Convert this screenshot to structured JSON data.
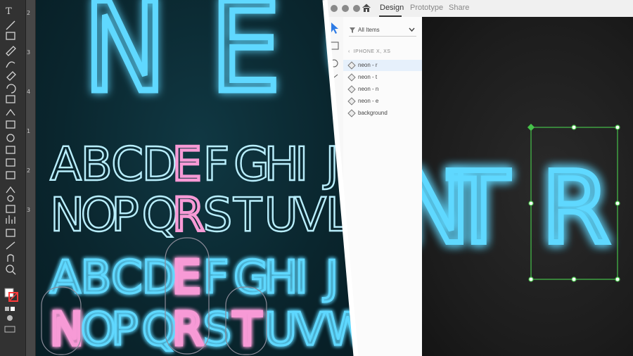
{
  "illustrator": {
    "ruler_marks": [
      "2",
      "3",
      "4",
      "1",
      "2",
      "3"
    ],
    "headline": "NEO",
    "alphabet_row1": [
      "A",
      "B",
      "C",
      "D",
      "E",
      "F",
      "G",
      "H",
      "I",
      "J"
    ],
    "alphabet_row2": [
      "N",
      "O",
      "P",
      "Q",
      "R",
      "S",
      "T",
      "U",
      "V",
      "L"
    ],
    "neon_row1": [
      "A",
      "B",
      "C",
      "D",
      "E",
      "F",
      "G",
      "H",
      "I",
      "J"
    ],
    "neon_row2": [
      "N",
      "O",
      "P",
      "Q",
      "R",
      "S",
      "T",
      "U",
      "V",
      "W"
    ]
  },
  "xd": {
    "tabs": [
      {
        "label": "Design",
        "active": true
      },
      {
        "label": "Prototype",
        "active": false
      },
      {
        "label": "Share",
        "active": false
      }
    ],
    "filter_label": "All Items",
    "artboard": "IPHONE X, XS",
    "layers": [
      "neon - r",
      "neon - t",
      "neon - n",
      "neon - e",
      "background"
    ],
    "canvas_letters": [
      "N",
      "T",
      "R"
    ]
  },
  "colors": {
    "neon": "#5fd8ff",
    "neon_core": "#d6f7ff",
    "selection": "#f79ad6",
    "xd_selection": "#46c24a",
    "xd_active_layer_bg": "#e6f0fb"
  }
}
